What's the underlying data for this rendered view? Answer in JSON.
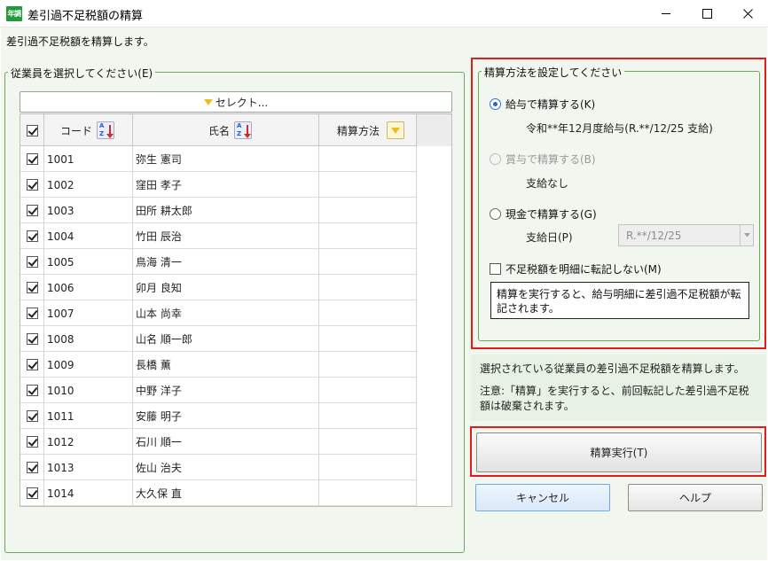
{
  "window": {
    "icon_text": "年調",
    "title": "差引過不足税額の精算"
  },
  "description": "差引過不足税額を精算します。",
  "employee_group": {
    "title": "従業員を選択してください(E)",
    "select_button": "セレクト...",
    "columns": {
      "code": "コード",
      "name": "氏名",
      "method": "精算方法"
    },
    "rows": [
      {
        "checked": true,
        "code": "1001",
        "name": "弥生 憲司",
        "method": ""
      },
      {
        "checked": true,
        "code": "1002",
        "name": "窪田 孝子",
        "method": ""
      },
      {
        "checked": true,
        "code": "1003",
        "name": "田所 耕太郎",
        "method": ""
      },
      {
        "checked": true,
        "code": "1004",
        "name": "竹田 辰治",
        "method": ""
      },
      {
        "checked": true,
        "code": "1005",
        "name": "鳥海 清一",
        "method": ""
      },
      {
        "checked": true,
        "code": "1006",
        "name": "卯月 良知",
        "method": ""
      },
      {
        "checked": true,
        "code": "1007",
        "name": "山本 尚幸",
        "method": ""
      },
      {
        "checked": true,
        "code": "1008",
        "name": "山名 順一郎",
        "method": ""
      },
      {
        "checked": true,
        "code": "1009",
        "name": "長橋 薫",
        "method": ""
      },
      {
        "checked": true,
        "code": "1010",
        "name": "中野 洋子",
        "method": ""
      },
      {
        "checked": true,
        "code": "1011",
        "name": "安藤 明子",
        "method": ""
      },
      {
        "checked": true,
        "code": "1012",
        "name": "石川 順一",
        "method": ""
      },
      {
        "checked": true,
        "code": "1013",
        "name": "佐山 治夫",
        "method": ""
      },
      {
        "checked": true,
        "code": "1014",
        "name": "大久保 直",
        "method": ""
      }
    ]
  },
  "settings_group": {
    "title": "精算方法を設定してください",
    "salary_option": "給与で精算する(K)",
    "salary_detail": "令和**年12月度給与(R.**/12/25 支給)",
    "bonus_option": "賞与で精算する(B)",
    "bonus_detail": "支給なし",
    "cash_option": "現金で精算する(G)",
    "payday_label": "支給日(P)",
    "payday_value": "R.**/12/25",
    "no_transfer_checkbox": "不足税額を明細に転記しない(M)",
    "note": "精算を実行すると、給与明細に差引過不足税額が転記されます。"
  },
  "info": {
    "line1": "選択されている従業員の差引過不足税額を精算します。",
    "line2": "注意:「精算」を実行すると、前回転記した差引過不足税額は破棄されます。"
  },
  "buttons": {
    "execute": "精算実行(T)",
    "cancel": "キャンセル",
    "help": "ヘルプ"
  },
  "colors": {
    "highlight": "#e21b1b",
    "group_border": "#6fa65f",
    "background": "#f1f6ef",
    "app_icon": "#1f9c3a"
  }
}
